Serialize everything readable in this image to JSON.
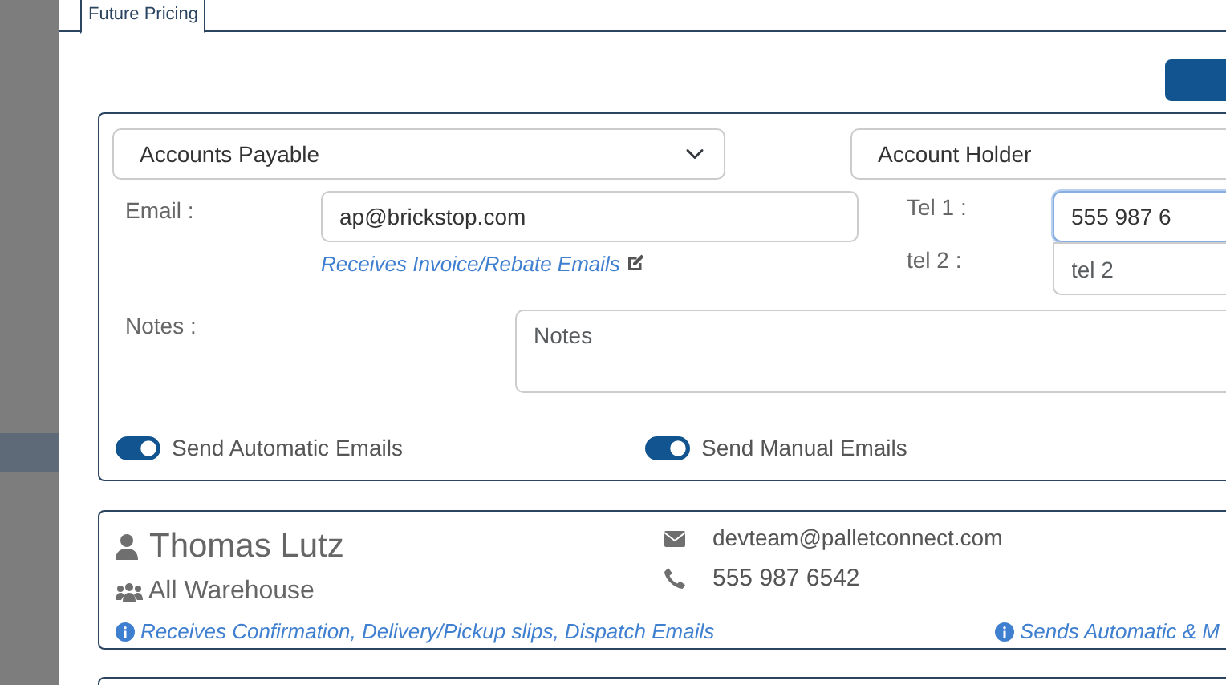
{
  "tabs": [
    {
      "label": "Future Pricing",
      "selected": true
    }
  ],
  "contact_form": {
    "role_select": {
      "value": "Accounts Payable"
    },
    "holder_select": {
      "value": "Account Holder"
    },
    "email": {
      "label": "Email :",
      "value": "ap@brickstop.com",
      "note": "Receives Invoice/Rebate Emails"
    },
    "tel_1": {
      "label": "Tel 1 :",
      "value": "555 987 6",
      "focused": true
    },
    "tel_2": {
      "label": "tel 2 :",
      "placeholder": "tel 2"
    },
    "notes": {
      "label": "Notes :",
      "placeholder": "Notes"
    },
    "toggles": [
      {
        "label": "Send Automatic Emails",
        "on": true
      },
      {
        "label": "Send Manual Emails",
        "on": true
      }
    ]
  },
  "contacts": [
    {
      "name": "Thomas Lutz",
      "group": "All Warehouse",
      "email": "devteam@palletconnect.com",
      "phone": "555 987 6542",
      "receives_note": "Receives Confirmation, Delivery/Pickup slips, Dispatch Emails",
      "sends_note": "Sends Automatic & M"
    }
  ]
}
